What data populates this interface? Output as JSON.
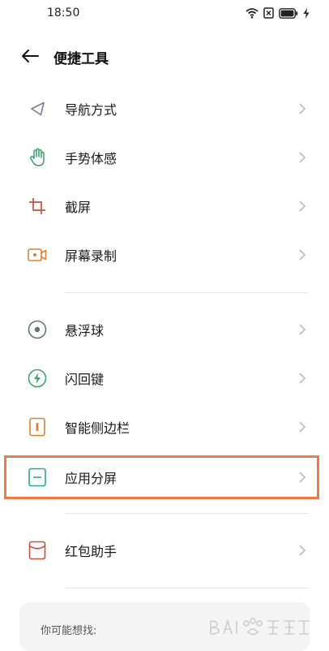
{
  "status_bar": {
    "time": "18:50",
    "icons": [
      "wifi-icon",
      "sim-x-icon",
      "battery-icon",
      "charging-icon"
    ]
  },
  "header": {
    "back_icon": "arrow-left-icon",
    "title": "便捷工具"
  },
  "items": [
    {
      "label": "导航方式",
      "icon": "navigation-icon",
      "color": "#7a7f8f"
    },
    {
      "label": "手势体感",
      "icon": "hand-icon",
      "color": "#3aa36a"
    },
    {
      "label": "截屏",
      "icon": "crop-icon",
      "color": "#c94f3e"
    },
    {
      "label": "屏幕录制",
      "icon": "video-record-icon",
      "color": "#d98133"
    },
    {
      "label": "悬浮球",
      "icon": "floating-ball-icon",
      "color": "#6a6f79"
    },
    {
      "label": "闪回键",
      "icon": "flash-key-icon",
      "color": "#3aa36a"
    },
    {
      "label": "智能侧边栏",
      "icon": "sidebar-icon",
      "color": "#d98133"
    },
    {
      "label": "应用分屏",
      "icon": "split-screen-icon",
      "color": "#2aa3a3"
    },
    {
      "label": "红包助手",
      "icon": "red-envelope-icon",
      "color": "#c94f3e"
    }
  ],
  "suggestions": {
    "title": "你可能想找:"
  },
  "colors": {
    "highlight": "#ee7a44",
    "chevron": "#bdbdbd"
  }
}
